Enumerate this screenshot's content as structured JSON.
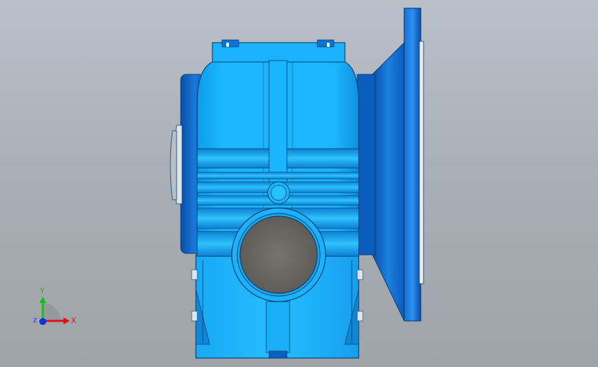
{
  "viewport": {
    "background_top": "#b9c0c9",
    "background_bottom": "#9fa4aa"
  },
  "model": {
    "colors": {
      "body": "#15b4ff",
      "body_light": "#38c6ff",
      "body_dark": "#0a6fc4",
      "edge": "#0b3e6e",
      "flange": "#0d6fd0",
      "shaft_face": "#6e6d66"
    }
  },
  "triad": {
    "x_label": "X",
    "y_label": "Y",
    "z_label": "Z",
    "x_color": "#e01010",
    "y_color": "#12c212",
    "z_color": "#1030e0"
  }
}
